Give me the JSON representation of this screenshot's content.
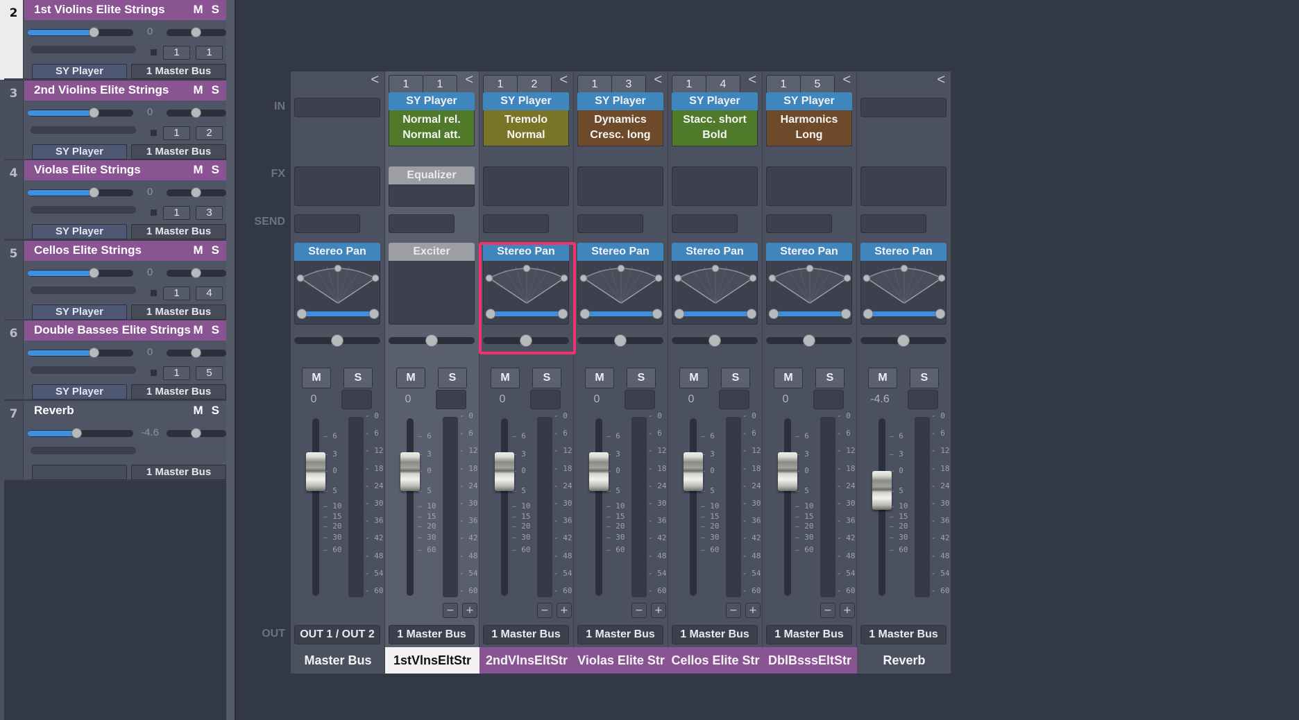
{
  "track_list": {
    "tracks": [
      {
        "number": "2",
        "name": "1st Violins Elite Strings",
        "mute": "M",
        "solo": "S",
        "volume": "0",
        "volume_fraction": 0.63,
        "pan_fraction": 0.5,
        "midi_port": "1",
        "midi_channel": "1",
        "instrument": "SY Player",
        "output": "1 Master Bus",
        "color": "purple",
        "selected": true
      },
      {
        "number": "3",
        "name": "2nd Violins Elite Strings",
        "mute": "M",
        "solo": "S",
        "volume": "0",
        "volume_fraction": 0.63,
        "pan_fraction": 0.5,
        "midi_port": "1",
        "midi_channel": "2",
        "instrument": "SY Player",
        "output": "1 Master Bus",
        "color": "purple",
        "selected": false
      },
      {
        "number": "4",
        "name": "Violas Elite Strings",
        "mute": "M",
        "solo": "S",
        "volume": "0",
        "volume_fraction": 0.63,
        "pan_fraction": 0.5,
        "midi_port": "1",
        "midi_channel": "3",
        "instrument": "SY Player",
        "output": "1 Master Bus",
        "color": "purple",
        "selected": false
      },
      {
        "number": "5",
        "name": "Cellos Elite Strings",
        "mute": "M",
        "solo": "S",
        "volume": "0",
        "volume_fraction": 0.63,
        "pan_fraction": 0.5,
        "midi_port": "1",
        "midi_channel": "4",
        "instrument": "SY Player",
        "output": "1 Master Bus",
        "color": "purple",
        "selected": false
      },
      {
        "number": "6",
        "name": "Double Basses Elite Strings",
        "mute": "M",
        "solo": "S",
        "volume": "0",
        "volume_fraction": 0.63,
        "pan_fraction": 0.5,
        "midi_port": "1",
        "midi_channel": "5",
        "instrument": "SY Player",
        "output": "1 Master Bus",
        "color": "purple",
        "selected": false
      },
      {
        "number": "7",
        "name": "Reverb",
        "mute": "M",
        "solo": "S",
        "volume": "-4.6",
        "volume_fraction": 0.47,
        "pan_fraction": 0.5,
        "midi_port": "",
        "midi_channel": "",
        "instrument": "",
        "output": "1 Master Bus",
        "color": "none",
        "selected": false
      }
    ]
  },
  "mixer": {
    "row_labels": {
      "in": "IN",
      "fx": "FX",
      "send": "SEND",
      "out": "OUT"
    },
    "collapse_glyph": "<",
    "mute_label": "M",
    "solo_label": "S",
    "minus_label": "−",
    "plus_label": "+",
    "fader_scale": [
      "6",
      "3",
      "0",
      "5",
      "10",
      "15",
      "20",
      "30",
      "60"
    ],
    "meter_scale": [
      "0",
      "6",
      "12",
      "18",
      "24",
      "30",
      "36",
      "42",
      "48",
      "54",
      "60"
    ],
    "strips": [
      {
        "name": "Master Bus",
        "name_style": "plain",
        "midi_port": "",
        "midi_channel": "",
        "input_plugin": "",
        "articulation": [],
        "articulation_color": "",
        "fx_plugin": "",
        "pan_plugin": "Stereo Pan",
        "gain": "0",
        "fader_db": 0,
        "output": "OUT 1 / OUT 2",
        "has_pm": false
      },
      {
        "name": "1stVlnsEltStr",
        "name_style": "white",
        "midi_port": "1",
        "midi_channel": "1",
        "input_plugin": "SY Player",
        "articulation": [
          "Normal rel.",
          "Normal att."
        ],
        "articulation_color": "#4e7a2a",
        "fx_plugin": "Equalizer",
        "pan_plugin": "Exciter",
        "gain": "0",
        "fader_db": 0,
        "output": "1 Master Bus",
        "has_pm": true,
        "selected": true
      },
      {
        "name": "2ndVlnsEltStr",
        "name_style": "purple",
        "midi_port": "1",
        "midi_channel": "2",
        "input_plugin": "SY Player",
        "articulation": [
          "Tremolo",
          "Normal"
        ],
        "articulation_color": "#7a7526",
        "fx_plugin": "",
        "pan_plugin": "Stereo Pan",
        "gain": "0",
        "fader_db": 0,
        "output": "1 Master Bus",
        "has_pm": true,
        "highlighted": true
      },
      {
        "name": "Violas Elite Str",
        "name_style": "purple",
        "midi_port": "1",
        "midi_channel": "3",
        "input_plugin": "SY Player",
        "articulation": [
          "Dynamics",
          "Cresc. long"
        ],
        "articulation_color": "#6f4a2a",
        "fx_plugin": "",
        "pan_plugin": "Stereo Pan",
        "gain": "0",
        "fader_db": 0,
        "output": "1 Master Bus",
        "has_pm": true
      },
      {
        "name": "Cellos Elite Str",
        "name_style": "purple",
        "midi_port": "1",
        "midi_channel": "4",
        "input_plugin": "SY Player",
        "articulation": [
          "Stacc. short",
          "Bold"
        ],
        "articulation_color": "#4e7a2a",
        "fx_plugin": "",
        "pan_plugin": "Stereo Pan",
        "gain": "0",
        "fader_db": 0,
        "output": "1 Master Bus",
        "has_pm": true
      },
      {
        "name": "DblBsssEltStr",
        "name_style": "purple",
        "midi_port": "1",
        "midi_channel": "5",
        "input_plugin": "SY Player",
        "articulation": [
          "Harmonics",
          "Long"
        ],
        "articulation_color": "#6f4a2a",
        "fx_plugin": "",
        "pan_plugin": "Stereo Pan",
        "gain": "0",
        "fader_db": 0,
        "output": "1 Master Bus",
        "has_pm": true
      },
      {
        "name": "Reverb",
        "name_style": "plain",
        "midi_port": "",
        "midi_channel": "",
        "input_plugin": "",
        "articulation": [],
        "articulation_color": "",
        "fx_plugin": "",
        "pan_plugin": "Stereo Pan",
        "gain": "-4.6",
        "fader_db": -4.6,
        "output": "1 Master Bus",
        "has_pm": false
      }
    ]
  },
  "colors": {
    "track_purple": "#8a5493",
    "plugin_blue": "#3f86bf",
    "highlight": "#f0326e",
    "slider_blue": "#3d8fe0"
  }
}
